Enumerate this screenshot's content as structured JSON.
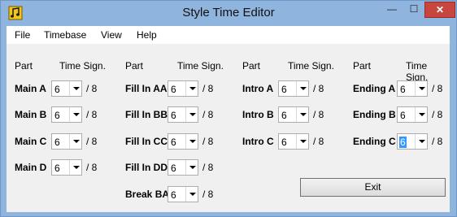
{
  "window": {
    "title": "Style Time Editor",
    "minimize": "—",
    "maximize": "☐",
    "close": "✕"
  },
  "menu": [
    "File",
    "Timebase",
    "View",
    "Help"
  ],
  "column_headers": {
    "part": "Part",
    "time_sign": "Time Sign."
  },
  "denominator": "/ 8",
  "groups": [
    [
      {
        "part": "Main A",
        "value": "6"
      },
      {
        "part": "Main B",
        "value": "6"
      },
      {
        "part": "Main C",
        "value": "6"
      },
      {
        "part": "Main D",
        "value": "6"
      }
    ],
    [
      {
        "part": "Fill In AA",
        "value": "6"
      },
      {
        "part": "Fill In BB",
        "value": "6"
      },
      {
        "part": "Fill In CC",
        "value": "6"
      },
      {
        "part": "Fill In DD",
        "value": "6"
      },
      {
        "part": "Break BA",
        "value": "6"
      }
    ],
    [
      {
        "part": "Intro A",
        "value": "6"
      },
      {
        "part": "Intro B",
        "value": "6"
      },
      {
        "part": "Intro C",
        "value": "6"
      }
    ],
    [
      {
        "part": "Ending A",
        "value": "6"
      },
      {
        "part": "Ending B",
        "value": "6"
      },
      {
        "part": "Ending C",
        "value": "6",
        "selected": true
      }
    ]
  ],
  "exit_label": "Exit"
}
